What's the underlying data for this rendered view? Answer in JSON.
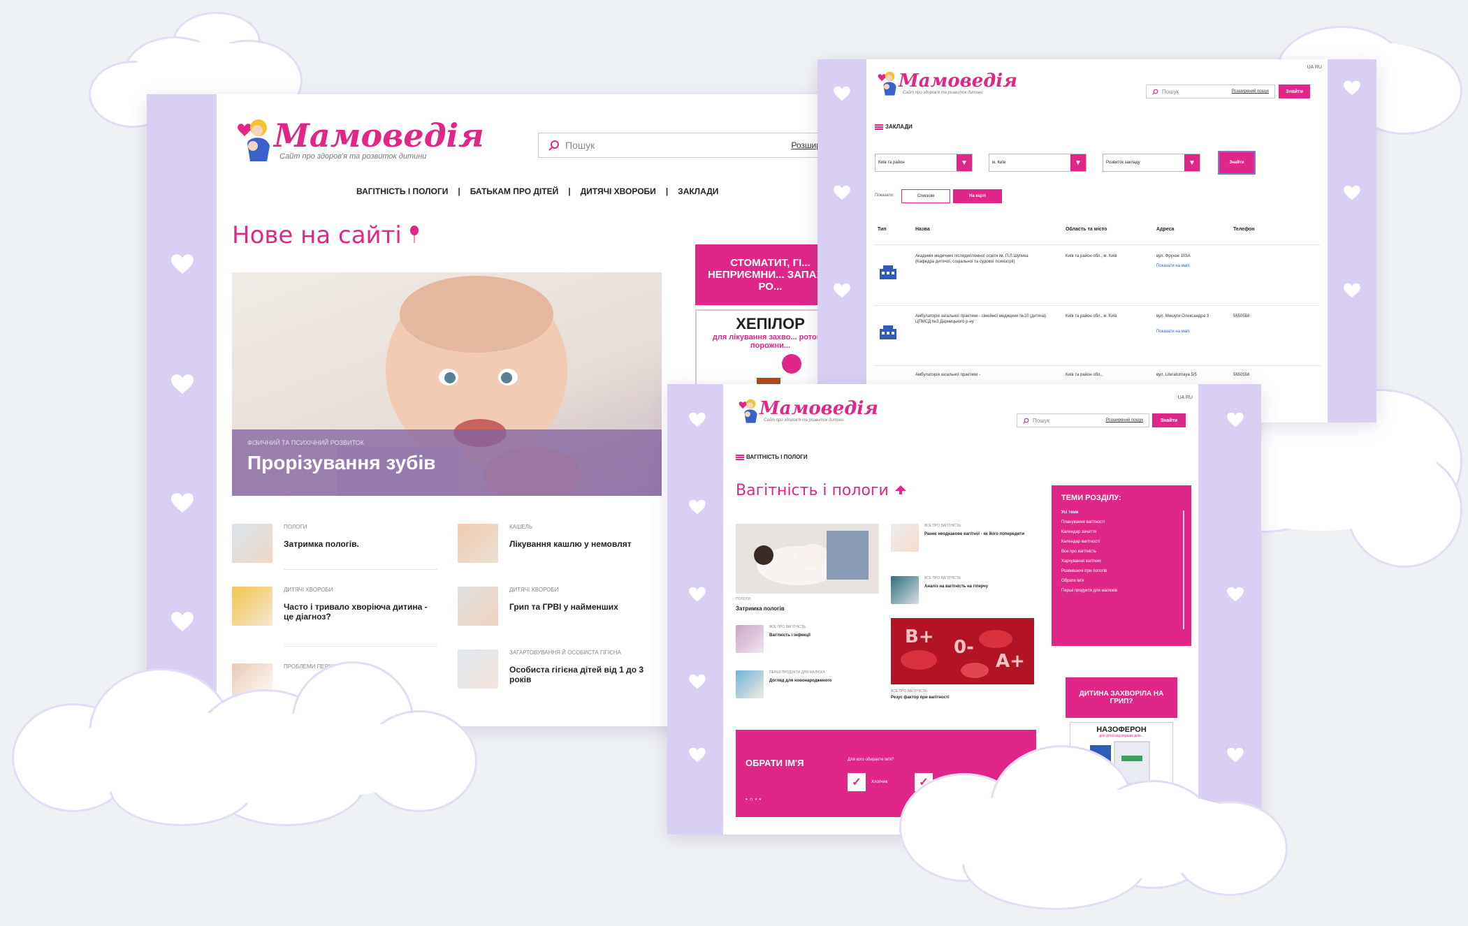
{
  "brand": {
    "name": "Мамоведія",
    "tagline": "Сайт про здоров'я та розвиток дитини",
    "lang": "UA RU",
    "accent": "#e1268a",
    "lavender": "#d9cff2"
  },
  "search": {
    "placeholder": "Пошук",
    "advanced": "Розширений пошук",
    "button": "Знайти"
  },
  "home": {
    "menu": [
      "ВАГІТНІСТЬ І ПОЛОГИ",
      "БАТЬКАМ ПРО ДІТЕЙ",
      "ДИТЯЧІ ХВОРОБИ",
      "ЗАКЛАДИ"
    ],
    "menu_sep": "|",
    "heading": "Нове на сайті",
    "hero": {
      "category": "ФІЗИЧНИЙ ТА ПСИХІЧНИЙ РОЗВИТОК",
      "title": "Прорізування зубів"
    },
    "ad": {
      "headline": "СТОМАТИТ, ГІ... НЕПРИЄМНИ... ЗАПАХ З РО...",
      "product": "ХЕПІЛОР",
      "sub": "для лікування захво... ротової порожни..."
    },
    "articles": [
      {
        "category": "ПОЛОГИ",
        "title": "Затримка пологів."
      },
      {
        "category": "КАШЕЛЬ",
        "title": "Лікування кашлю у немовлят"
      },
      {
        "category": "ДИТЯЧІ ХВОРОБИ",
        "title": "Часто і тривало хворіюча дитина - це діагноз?"
      },
      {
        "category": "ДИТЯЧІ ХВОРОБИ",
        "title": "Грип та ГРВІ у найменших"
      },
      {
        "category": "ПРОБЛЕМИ ПЕРШОГО РОКУ",
        "title": ""
      },
      {
        "category": "ЗАГАРТОВУВАННЯ Й ОСОБИСТА ГІГІЄНА",
        "title": "Особиста гігієна дітей від 1 до 3 років"
      }
    ]
  },
  "facilities": {
    "section": "ЗАКЛАДИ",
    "filters": [
      "Київ та район",
      "м. Київ",
      "Розвиток закладу"
    ],
    "find": "Знайти",
    "show_label": "Показати:",
    "views": [
      "Списком",
      "На карті"
    ],
    "columns": [
      "Тип",
      "Назва",
      "Область та місто",
      "Адреса",
      "Телефон"
    ],
    "rows": [
      {
        "name": "Академія медичних післядипломної освіти ім. П.Л.Шупика (Кафедра дитячої, соціальної та судової психіатрії)",
        "region": "Київ та район обл., м. Київ",
        "address": "вул. Фрунзе 103А",
        "map": "Показати на мапі",
        "phone": ""
      },
      {
        "name": "Амбулаторія загальної практики - сімейної медицини №10 (дитяча) ЦПМСД №3 Дарницького р-ну",
        "region": "Київ та район обл., м. Київ",
        "address": "вул. Мишуги Олександра 3",
        "map": "Показати на мапі",
        "phone": "5650558"
      },
      {
        "name": "Амбулаторія загальної практики -",
        "region": "Київ та район обл.,",
        "address": "вул. Literaturnaya 5/5",
        "map": "",
        "phone": "5650558"
      }
    ]
  },
  "pregnancy": {
    "section": "ВАГІТНІСТЬ І ПОЛОГИ",
    "heading": "Вагітність і пологи",
    "main_item": {
      "category": "ПОЛОГИ",
      "title": "Затримка пологів"
    },
    "side_items": [
      {
        "category": "ВСЕ ПРО ВАГІТНІСТЬ",
        "title": "Раннє неоднакове вагітної - як його попередити"
      },
      {
        "category": "ВСЕ ПРО ВАГІТНІСТЬ",
        "title": "Аналіз на вагітність на гіперчу"
      },
      {
        "category": "ВСЕ ПРО ВАГІТНІСТЬ",
        "title": "Вагітність і інфекції"
      },
      {
        "category": "ПЕРШІ ПРОДУКТИ ДЛЯ МАЛЮКА",
        "title": "Догляд для новонародженого"
      },
      {
        "category": "ВСЕ ПРО ВАГІТНІСТЬ",
        "title": "Резус фактор при вагітності"
      }
    ],
    "topics_title": "ТЕМИ РОЗДІЛУ:",
    "topics": [
      "Усі теми",
      "Планування вагітності",
      "Календар зачаття",
      "Календар вагітності",
      "Все про вагітність",
      "Харчування вагітних",
      "Розвиваючі ігри пологів",
      "Обрати ім'я",
      "Перші продукти для малюків"
    ],
    "name_block": {
      "title": "ОБРАТИ ІМ'Я",
      "question": "Для кого обираєте ім'я?",
      "option": "Хлопчик"
    },
    "ad": {
      "headline": "ДИТИНА ЗАХВОРІЛА НА ГРИП?",
      "product": "НАЗОФЕРОН",
      "sub": "для дітей від перших днів..."
    }
  }
}
